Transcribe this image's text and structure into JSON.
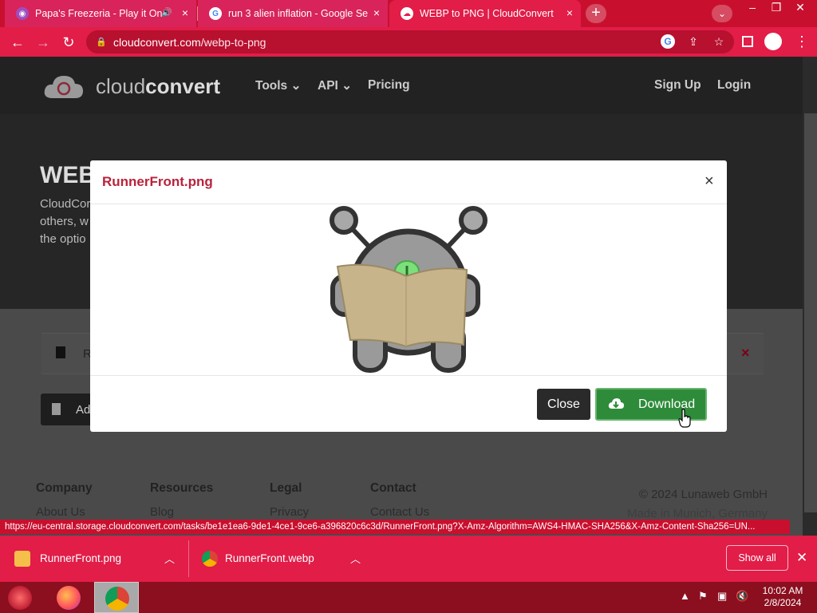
{
  "browser": {
    "tabs": [
      {
        "title": "Papa's Freezeria - Play it Onl",
        "state": "inactive"
      },
      {
        "title": "run 3 alien inflation - Google Se",
        "state": "inactive"
      },
      {
        "title": "WEBP to PNG | CloudConvert",
        "state": "active"
      }
    ],
    "url_host": "cloudconvert.com",
    "url_path": "/webp-to-png",
    "newtab_label": "+",
    "close_glyph": "×"
  },
  "site": {
    "logo_light": "cloud",
    "logo_bold": "convert",
    "nav": {
      "tools": "Tools",
      "api": "API",
      "pricing": "Pricing",
      "signup": "Sign Up",
      "login": "Login"
    },
    "hero_title": "WEB",
    "hero_lines": [
      "CloudCor",
      "others, w",
      "the optio"
    ],
    "file_row_name": "R",
    "add_button": "Ad",
    "footer": {
      "company": "Company",
      "about": "About Us",
      "resources": "Resources",
      "blog": "Blog",
      "legal": "Legal",
      "privacy": "Privacy",
      "contact": "Contact",
      "contact_us": "Contact Us",
      "copyright": "© 2024 Lunaweb GmbH",
      "made_in": "Made in Munich, Germany"
    }
  },
  "status_url": "https://eu-central.storage.cloudconvert.com/tasks/be1e1ea6-9de1-4ce1-9ce6-a396820c6c3d/RunnerFront.png?X-Amz-Algorithm=AWS4-HMAC-SHA256&X-Amz-Content-Sha256=UN...",
  "modal": {
    "title": "RunnerFront.png",
    "close_x": "×",
    "close_button": "Close",
    "download_button": "Download"
  },
  "downloads": {
    "items": [
      {
        "name": "RunnerFront.png",
        "icon": "image-file-icon"
      },
      {
        "name": "RunnerFront.webp",
        "icon": "chrome-icon"
      }
    ],
    "show_all": "Show all"
  },
  "taskbar": {
    "time": "10:02 AM",
    "date": "2/8/2024"
  },
  "colors": {
    "browser_red": "#e11d48",
    "modal_title": "#b8233c",
    "download_green": "#2e8b3a"
  }
}
